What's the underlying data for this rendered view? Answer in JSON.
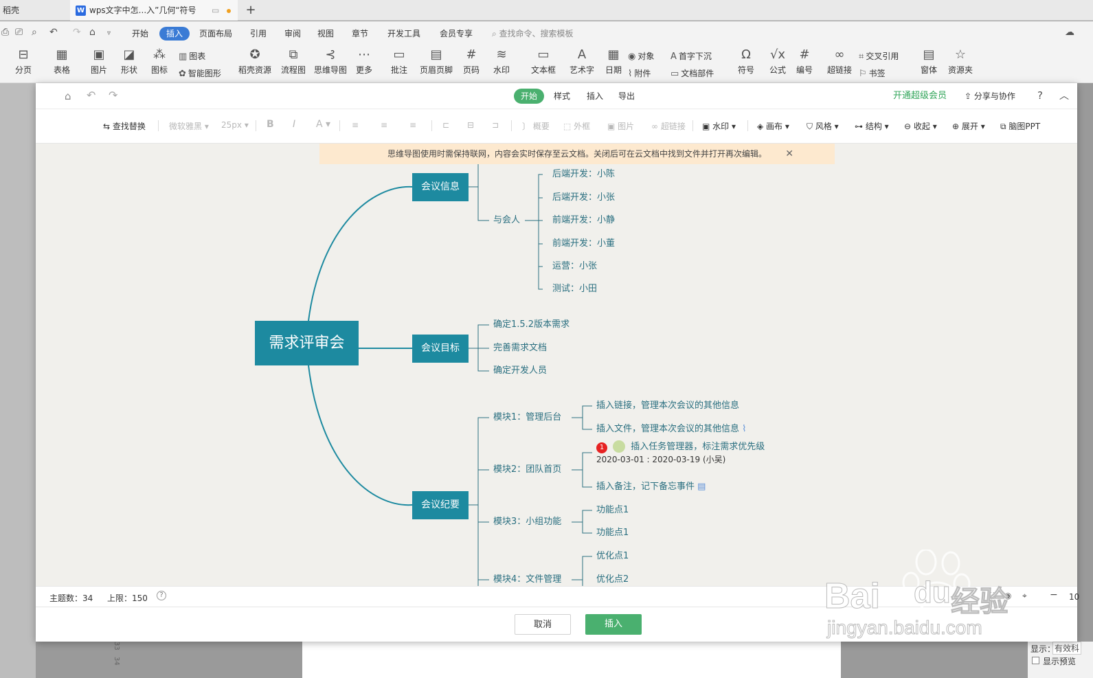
{
  "tabs": {
    "home": "稻壳",
    "doc": "wps文字中怎...入”几何“符号",
    "new": "+"
  },
  "menu": {
    "items": [
      "开始",
      "插入",
      "页面布局",
      "引用",
      "审阅",
      "视图",
      "章节",
      "开发工具",
      "会员专享"
    ],
    "search": "查找命令、搜索模板"
  },
  "ribbon": {
    "big": [
      "分页",
      "表格",
      "图片",
      "形状",
      "图标",
      "稻壳资源",
      "流程图",
      "思维导图",
      "更多",
      "批注",
      "页眉页脚",
      "页码",
      "水印",
      "文本框",
      "艺术字",
      "日期",
      "符号",
      "公式",
      "编号",
      "超链接",
      "窗体",
      "资源夹"
    ],
    "small": [
      "图表",
      "智能图形",
      "对象",
      "附件",
      "首字下沉",
      "文档部件",
      "交叉引用",
      "书签"
    ]
  },
  "dialog": {
    "tabs": [
      "开始",
      "样式",
      "插入",
      "导出"
    ],
    "vip": "开通超级会员",
    "share": "分享与协作",
    "help": "?",
    "tools": {
      "find_replace": "查找替换",
      "font": "微软雅黑",
      "size": "25px",
      "bold": "B",
      "italic": "I",
      "color": "A",
      "summary": "概要",
      "outline": "外框",
      "image": "图片",
      "hyperlink": "超链接",
      "watermark": "水印",
      "canvas": "画布",
      "style": "风格",
      "structure": "结构",
      "collapse": "收起",
      "expand": "展开",
      "mind_ppt": "脑图PPT"
    },
    "notice": "思维导图使用时需保持联网，内容会实时保存至云文档。关闭后可在云文档中找到文件并打开再次编辑。",
    "mindmap": {
      "root": "需求评审会",
      "branches": {
        "info": "会议信息",
        "goal": "会议目标",
        "minutes": "会议纪要"
      },
      "attendees_label": "与会人",
      "attendees": [
        "后端开发：小陈",
        "后端开发：小张",
        "前端开发：小静",
        "前端开发：小董",
        "运营：小张",
        "测试：小田"
      ],
      "goals": [
        "确定1.5.2版本需求",
        "完善需求文档",
        "确定开发人员"
      ],
      "modules": [
        "模块1：管理后台",
        "模块2：团队首页",
        "模块3：小组功能",
        "模块4：文件管理"
      ],
      "m1": [
        "插入链接，管理本次会议的其他信息",
        "插入文件，管理本次会议的其他信息"
      ],
      "m2_task": "插入任务管理器，标注需求优先级",
      "m2_priority": "1",
      "m2_date": "2020-03-01 : 2020-03-19 (小吴)",
      "m2_note": "插入备注，记下备忘事件",
      "m3": [
        "功能点1",
        "功能点1"
      ],
      "m4": [
        "优化点1",
        "优化点2"
      ]
    },
    "status": {
      "topics": "主题数：34",
      "limit": "上限：150",
      "zoom": "10"
    },
    "cancel": "取消",
    "insert": "插入"
  },
  "side": {
    "show_label": "显示：",
    "show_value": "有效科",
    "preview": "显示预览"
  },
  "ruler": [
    "33",
    "34"
  ],
  "watermark": {
    "brand": "Bai",
    "brand2": "du",
    "cn": "经验",
    "url": "jingyan.baidu.com"
  },
  "colors": {
    "accent": "#1d8aa0",
    "green": "#4ab06f",
    "menu_active": "#3a7bd5"
  }
}
